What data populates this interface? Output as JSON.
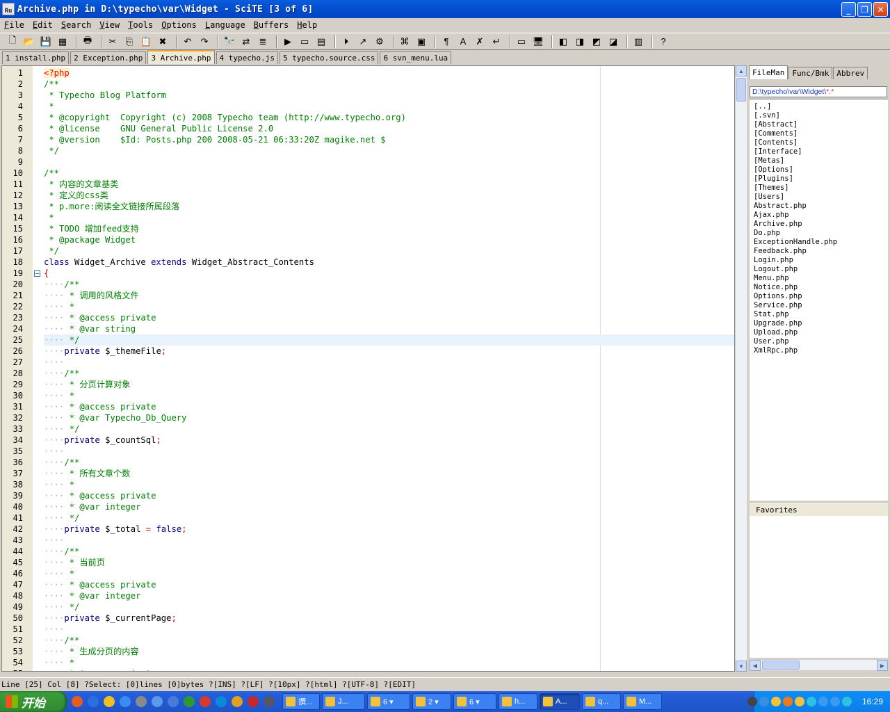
{
  "window": {
    "app_icon_text": "Ru",
    "title": "Archive.php in D:\\typecho\\var\\Widget - SciTE [3 of 6]",
    "controls": [
      "_",
      "❐",
      "✕"
    ]
  },
  "menu": [
    "File",
    "Edit",
    "Search",
    "View",
    "Tools",
    "Options",
    "Language",
    "Buffers",
    "Help"
  ],
  "toolbar": {
    "icons": [
      "new-file-icon",
      "open-file-icon",
      "save-icon",
      "save-all-icon",
      "|",
      "print-icon",
      "|",
      "cut-icon",
      "copy-icon",
      "paste-icon",
      "delete-icon",
      "|",
      "undo-icon",
      "redo-icon",
      "|",
      "find-icon",
      "find-replace-icon",
      "find-in-files-icon",
      "|",
      "go-icon",
      "compile-icon",
      "build-icon",
      "|",
      "run-icon",
      "step-icon",
      "debug-icon",
      "|",
      "command-icon",
      "console-icon",
      "|",
      "pilcrow-icon",
      "spell-icon",
      "close-x-icon",
      "wrap-icon",
      "|",
      "split-icon",
      "monitor-icon",
      "|",
      "tool1-icon",
      "tool2-icon",
      "tool3-icon",
      "tool4-icon",
      "|",
      "sidebar-icon",
      "|",
      "help-icon"
    ],
    "glyphs": {
      "new-file-icon": "🗋",
      "open-file-icon": "📂",
      "save-icon": "💾",
      "save-all-icon": "▦",
      "print-icon": "🖶",
      "cut-icon": "✂",
      "copy-icon": "⎘",
      "paste-icon": "📋",
      "delete-icon": "✖",
      "undo-icon": "↶",
      "redo-icon": "↷",
      "find-icon": "🔭",
      "find-replace-icon": "⇄",
      "find-in-files-icon": "≣",
      "go-icon": "▶",
      "compile-icon": "▭",
      "build-icon": "▤",
      "run-icon": "⏵",
      "step-icon": "↗",
      "debug-icon": "⚙",
      "command-icon": "⌘",
      "console-icon": "▣",
      "pilcrow-icon": "¶",
      "spell-icon": "A",
      "close-x-icon": "✗",
      "wrap-icon": "↵",
      "split-icon": "▭",
      "monitor-icon": "🖥",
      "tool1-icon": "◧",
      "tool2-icon": "◨",
      "tool3-icon": "◩",
      "tool4-icon": "◪",
      "sidebar-icon": "▥",
      "help-icon": "?"
    }
  },
  "tabs": [
    {
      "label": "1 install.php",
      "active": false
    },
    {
      "label": "2 Exception.php",
      "active": false
    },
    {
      "label": "3 Archive.php",
      "active": true
    },
    {
      "label": "4 typecho.js",
      "active": false
    },
    {
      "label": "5 typecho.source.css",
      "active": false
    },
    {
      "label": "6 svn_menu.lua",
      "active": false
    }
  ],
  "editor": {
    "current_line": 25,
    "fold_marker_line": 19,
    "lines": [
      [
        [
          "ph",
          "<?php"
        ]
      ],
      [
        [
          "c",
          "/**"
        ]
      ],
      [
        [
          "c",
          " * Typecho Blog Platform"
        ]
      ],
      [
        [
          "c",
          " *"
        ]
      ],
      [
        [
          "c",
          " * @copyright  Copyright (c) 2008 Typecho team (http://www.typecho.org)"
        ]
      ],
      [
        [
          "c",
          " * @license    GNU General Public License 2.0"
        ]
      ],
      [
        [
          "c",
          " * @version    $Id: Posts.php 200 2008-05-21 06:33:20Z magike.net $"
        ]
      ],
      [
        [
          "c",
          " */"
        ]
      ],
      [
        [
          "t",
          ""
        ]
      ],
      [
        [
          "c",
          "/**"
        ]
      ],
      [
        [
          "c",
          " * 内容的文章基类"
        ]
      ],
      [
        [
          "c",
          " * 定义的css类"
        ]
      ],
      [
        [
          "c",
          " * p.more:阅读全文链接所属段落"
        ]
      ],
      [
        [
          "c",
          " *"
        ]
      ],
      [
        [
          "c",
          " * TODO 增加feed支持"
        ]
      ],
      [
        [
          "c",
          " * @package Widget"
        ]
      ],
      [
        [
          "c",
          " */"
        ]
      ],
      [
        [
          "k",
          "class"
        ],
        [
          "t",
          " Widget_Archive "
        ],
        [
          "k",
          "extends"
        ],
        [
          "t",
          " Widget_Abstract_Contents"
        ]
      ],
      [
        [
          "o",
          "{"
        ]
      ],
      [
        [
          "w",
          "    "
        ],
        [
          "c",
          "/**"
        ]
      ],
      [
        [
          "w",
          "    "
        ],
        [
          "c",
          " * 调用的风格文件"
        ]
      ],
      [
        [
          "w",
          "    "
        ],
        [
          "c",
          " *"
        ]
      ],
      [
        [
          "w",
          "    "
        ],
        [
          "c",
          " * @access private"
        ]
      ],
      [
        [
          "w",
          "    "
        ],
        [
          "c",
          " * @var string"
        ]
      ],
      [
        [
          "w",
          "    "
        ],
        [
          "c",
          " */"
        ]
      ],
      [
        [
          "w",
          "    "
        ],
        [
          "k",
          "private"
        ],
        [
          "t",
          " $_themeFile"
        ],
        [
          "o",
          ";"
        ]
      ],
      [
        [
          "w",
          "    "
        ]
      ],
      [
        [
          "w",
          "    "
        ],
        [
          "c",
          "/**"
        ]
      ],
      [
        [
          "w",
          "    "
        ],
        [
          "c",
          " * 分页计算对象"
        ]
      ],
      [
        [
          "w",
          "    "
        ],
        [
          "c",
          " *"
        ]
      ],
      [
        [
          "w",
          "    "
        ],
        [
          "c",
          " * @access private"
        ]
      ],
      [
        [
          "w",
          "    "
        ],
        [
          "c",
          " * @var Typecho_Db_Query"
        ]
      ],
      [
        [
          "w",
          "    "
        ],
        [
          "c",
          " */"
        ]
      ],
      [
        [
          "w",
          "    "
        ],
        [
          "k",
          "private"
        ],
        [
          "t",
          " $_countSql"
        ],
        [
          "o",
          ";"
        ]
      ],
      [
        [
          "w",
          "    "
        ]
      ],
      [
        [
          "w",
          "    "
        ],
        [
          "c",
          "/**"
        ]
      ],
      [
        [
          "w",
          "    "
        ],
        [
          "c",
          " * 所有文章个数"
        ]
      ],
      [
        [
          "w",
          "    "
        ],
        [
          "c",
          " *"
        ]
      ],
      [
        [
          "w",
          "    "
        ],
        [
          "c",
          " * @access private"
        ]
      ],
      [
        [
          "w",
          "    "
        ],
        [
          "c",
          " * @var integer"
        ]
      ],
      [
        [
          "w",
          "    "
        ],
        [
          "c",
          " */"
        ]
      ],
      [
        [
          "w",
          "    "
        ],
        [
          "k",
          "private"
        ],
        [
          "t",
          " $_total "
        ],
        [
          "o",
          "="
        ],
        [
          "t",
          " "
        ],
        [
          "k",
          "false"
        ],
        [
          "o",
          ";"
        ]
      ],
      [
        [
          "w",
          "    "
        ]
      ],
      [
        [
          "w",
          "    "
        ],
        [
          "c",
          "/**"
        ]
      ],
      [
        [
          "w",
          "    "
        ],
        [
          "c",
          " * 当前页"
        ]
      ],
      [
        [
          "w",
          "    "
        ],
        [
          "c",
          " *"
        ]
      ],
      [
        [
          "w",
          "    "
        ],
        [
          "c",
          " * @access private"
        ]
      ],
      [
        [
          "w",
          "    "
        ],
        [
          "c",
          " * @var integer"
        ]
      ],
      [
        [
          "w",
          "    "
        ],
        [
          "c",
          " */"
        ]
      ],
      [
        [
          "w",
          "    "
        ],
        [
          "k",
          "private"
        ],
        [
          "t",
          " $_currentPage"
        ],
        [
          "o",
          ";"
        ]
      ],
      [
        [
          "w",
          "    "
        ]
      ],
      [
        [
          "w",
          "    "
        ],
        [
          "c",
          "/**"
        ]
      ],
      [
        [
          "w",
          "    "
        ],
        [
          "c",
          " * 生成分页的内容"
        ]
      ],
      [
        [
          "w",
          "    "
        ],
        [
          "c",
          " *"
        ]
      ],
      [
        [
          "w",
          "    "
        ],
        [
          "c",
          " * @access private"
        ]
      ]
    ]
  },
  "sidebar": {
    "tabs": [
      {
        "label": "FileMan",
        "active": true
      },
      {
        "label": "Func/Bmk",
        "active": false
      },
      {
        "label": "Abbrev",
        "active": false
      }
    ],
    "path": "D:\\typecho\\var\\Widget\\",
    "path_filter": "*.*",
    "files": [
      "[..]",
      "[.svn]",
      "[Abstract]",
      "[Comments]",
      "[Contents]",
      "[Interface]",
      "[Metas]",
      "[Options]",
      "[Plugins]",
      "[Themes]",
      "[Users]",
      "Abstract.php",
      "Ajax.php",
      "Archive.php",
      "Do.php",
      "ExceptionHandle.php",
      "Feedback.php",
      "Login.php",
      "Logout.php",
      "Menu.php",
      "Notice.php",
      "Options.php",
      "Service.php",
      "Stat.php",
      "Upgrade.php",
      "Upload.php",
      "User.php",
      "XmlRpc.php"
    ],
    "favorites_label": "Favorites"
  },
  "status": "Line [25] Col [8] ?Select: [0]lines [0]bytes ?[INS] ?[LF] ?[10px] ?[html] ?[UTF-8] ?[EDIT]",
  "taskbar": {
    "start_label": "开始",
    "quicklaunch_colors": [
      "#e85c1e",
      "#2b6fe0",
      "#f0c020",
      "#3a8df0",
      "#8a8a8a",
      "#5a9ae8",
      "#4a7ad8",
      "#2e9a2e",
      "#d83a2a",
      "#0a8ad8",
      "#e0a020",
      "#c82828",
      "#556"
    ],
    "tasks": [
      {
        "label": "撰...",
        "width": 54,
        "active": false
      },
      {
        "label": "J...",
        "width": 62,
        "active": false
      },
      {
        "label": "6 ▾",
        "width": 62,
        "active": false
      },
      {
        "label": "2 ▾",
        "width": 56,
        "active": false
      },
      {
        "label": "6 ▾",
        "width": 62,
        "active": false
      },
      {
        "label": "h...",
        "width": 56,
        "active": false
      },
      {
        "label": "A...",
        "width": 58,
        "active": true
      },
      {
        "label": "q...",
        "width": 56,
        "active": false
      },
      {
        "label": "M...",
        "width": 56,
        "active": false
      }
    ],
    "clock": "16:29",
    "tray_colors": [
      "#444",
      "#3b8de0",
      "#f3c13a",
      "#f07a1a",
      "#f3c13a",
      "#2ec0e0",
      "#3a9af0",
      "#3a9af0",
      "#2ec0e0"
    ]
  }
}
